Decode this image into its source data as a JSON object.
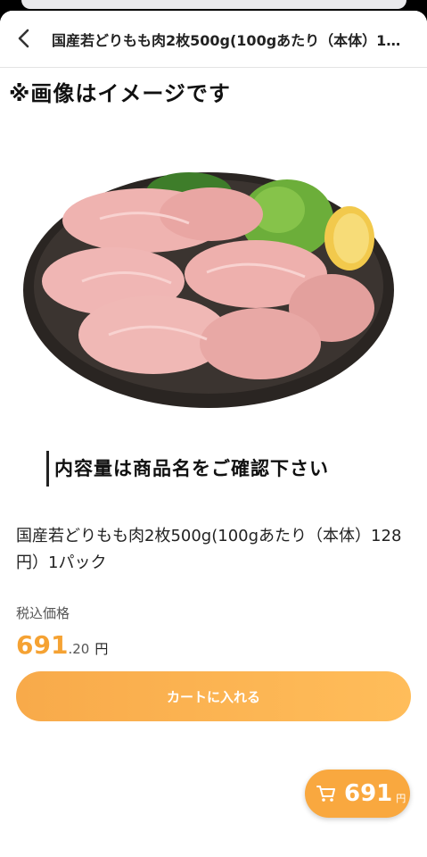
{
  "header": {
    "title": "国産若どりもも肉2枚500g(100gあたり（本体）128円）1パック"
  },
  "product_image": {
    "note_top": "※画像はイメージです",
    "note_bottom": "内容量は商品名をご確認下さい"
  },
  "product": {
    "name": "国産若どりもも肉2枚500g(100gあたり（本体）128円）1パック",
    "tax_label": "税込価格",
    "price_integer": "691",
    "price_decimal": ".20",
    "price_unit": "円"
  },
  "actions": {
    "add_to_cart": "カートに入れる"
  },
  "cart_fab": {
    "total": "691",
    "unit": "円"
  },
  "colors": {
    "accent": "#f5a233",
    "button": "#f8aa4a"
  }
}
